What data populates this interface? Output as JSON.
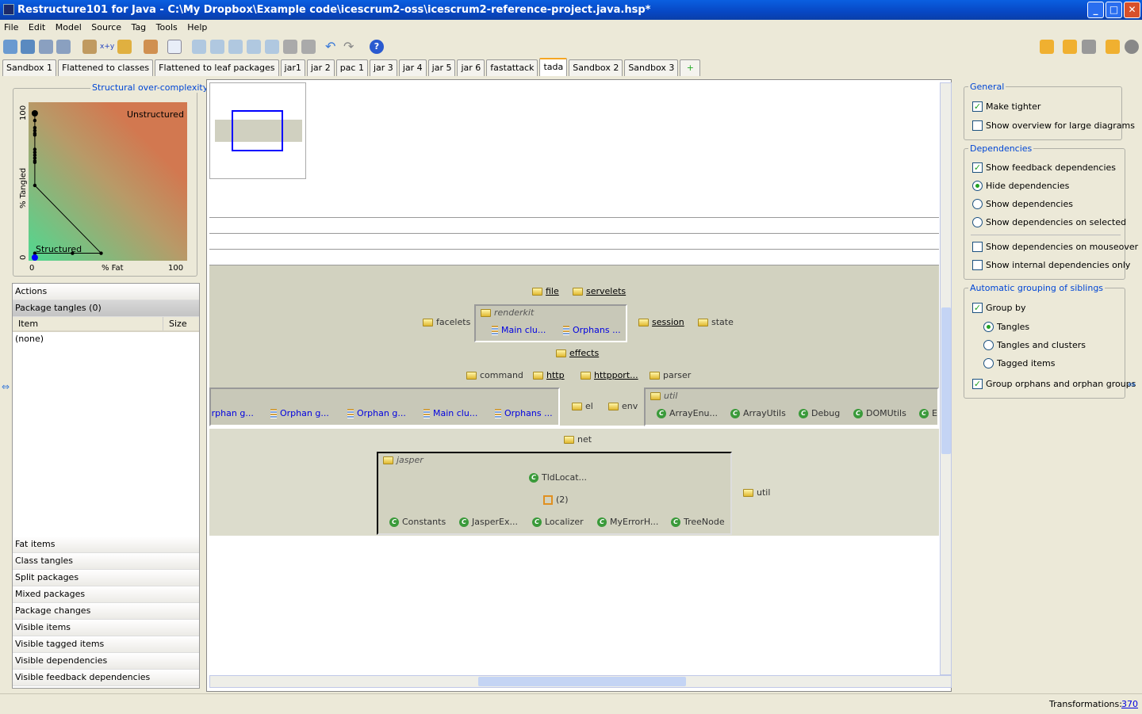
{
  "window": {
    "title": "Restructure101 for Java - C:\\My Dropbox\\Example code\\icescrum2-oss\\icescrum2-reference-project.java.hsp*"
  },
  "menu": [
    "File",
    "Edit",
    "Model",
    "Source",
    "Tag",
    "Tools",
    "Help"
  ],
  "toolbar_icons": [
    "new-icon",
    "open-icon",
    "save-icon",
    "save-as-icon",
    "properties-icon",
    "xy-icon",
    "refresh-icon",
    "tag-icon",
    "java-icon",
    "add-action-icon",
    "remove-action-icon",
    "remove-all-icon",
    "move-icon",
    "move-all-icon",
    "disabled-icon",
    "disabled-icon-2",
    "undo-icon",
    "redo-icon",
    "help-icon"
  ],
  "tabs": [
    "Sandbox 1",
    "Flattened to classes",
    "Flattened to leaf packages",
    "jar1",
    "jar 2",
    "pac 1",
    "jar 3",
    "jar 4",
    "jar 5",
    "jar 6",
    "fastattack",
    "tada",
    "Sandbox 2",
    "Sandbox 3"
  ],
  "active_tab": "tada",
  "chart_data": {
    "type": "line",
    "title": "Structural over-complexity",
    "xlabel": "% Fat",
    "ylabel": "% Tangled",
    "xlim": [
      0,
      100
    ],
    "ylim": [
      0,
      100
    ],
    "xticks": [
      "0",
      "100"
    ],
    "yticks": [
      "0",
      "100"
    ],
    "annotations": [
      "Unstructured",
      "Structured"
    ],
    "points": [
      [
        1,
        100
      ],
      [
        1,
        95
      ],
      [
        1,
        90
      ],
      [
        1,
        88
      ],
      [
        1,
        86
      ],
      [
        1,
        85
      ],
      [
        1,
        75
      ],
      [
        1,
        73
      ],
      [
        1,
        71
      ],
      [
        1,
        69
      ],
      [
        1,
        67
      ],
      [
        1,
        66
      ],
      [
        1,
        50
      ],
      [
        45,
        3
      ],
      [
        26,
        3
      ],
      [
        1,
        3
      ]
    ],
    "current_point": [
      1,
      0
    ]
  },
  "left_panel": {
    "actions": "Actions",
    "package_tangles": "Package tangles (0)",
    "col_item": "Item",
    "col_size": "Size",
    "none": "(none)",
    "sections": [
      "Fat items",
      "Class tangles",
      "Split packages",
      "Mixed packages",
      "Package changes",
      "Visible items",
      "Visible tagged items",
      "Visible dependencies",
      "Visible feedback dependencies"
    ]
  },
  "diagram": {
    "top": [
      {
        "n": "file",
        "link": true
      },
      {
        "n": "servelets",
        "link": true
      }
    ],
    "facelets": "facelets",
    "renderkit": "renderkit",
    "renderkit_items": [
      "Main clu...",
      "Orphans ..."
    ],
    "session": "session",
    "state": "state",
    "effects": "effects",
    "row2": [
      {
        "n": "command",
        "link": false
      },
      {
        "n": "http",
        "link": true
      },
      {
        "n": "httpport...",
        "link": true
      },
      {
        "n": "parser",
        "link": false
      }
    ],
    "groups": [
      "Orphan g...",
      "Orphan g...",
      "Orphan g...",
      "Main clu...",
      "Orphans ..."
    ],
    "el": "el",
    "env": "env",
    "util_box": "util",
    "util_items": [
      "ArrayEnu...",
      "ArrayUtils",
      "Debug",
      "DOMUtils",
      "E"
    ],
    "net": "net",
    "jasper": "jasper",
    "tld": "TldLocat...",
    "tangle": "(2)",
    "jasper_items": [
      "Constants",
      "JasperEx...",
      "Localizer",
      "MyErrorH...",
      "TreeNode"
    ],
    "util": "util"
  },
  "right_panel": {
    "general": "General",
    "make_tighter": "Make tighter",
    "show_overview": "Show overview for large diagrams",
    "dependencies": "Dependencies",
    "feedback": "Show feedback dependencies",
    "hide": "Hide dependencies",
    "show": "Show dependencies",
    "show_selected": "Show dependencies on selected",
    "mouseover": "Show dependencies on mouseover",
    "internal": "Show internal dependencies only",
    "grouping": "Automatic grouping of siblings",
    "group_by": "Group by",
    "tangles": "Tangles",
    "tangles_clusters": "Tangles and clusters",
    "tagged": "Tagged items",
    "orphans": "Group orphans and orphan groups"
  },
  "status": {
    "label": "Transformations:",
    "value": "370"
  }
}
